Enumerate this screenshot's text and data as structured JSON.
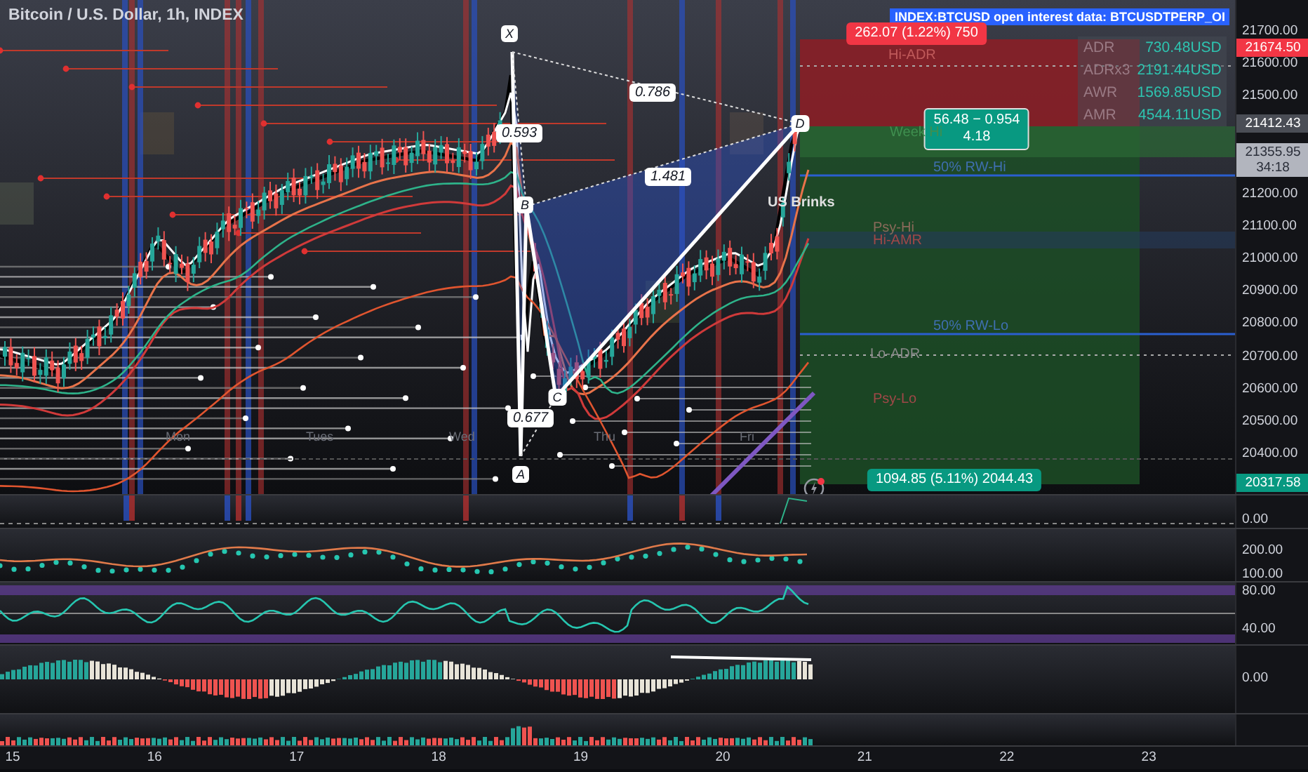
{
  "chart": {
    "title": "Bitcoin / U.S. Dollar, 1h, INDEX",
    "info_banner": "INDEX:BTCUSD open interest data: BTCUSDTPERP_OI",
    "stats": [
      {
        "label": "ADR",
        "value": "730.48USD"
      },
      {
        "label": "ADRx3",
        "value": "2191.44USD"
      },
      {
        "label": "AWR",
        "value": "1569.85USD"
      },
      {
        "label": "AMR",
        "value": "4544.11USD"
      }
    ],
    "pattern_points": [
      "X",
      "A",
      "B",
      "C",
      "D"
    ],
    "ratios": [
      "0.786",
      "0.593",
      "1.481",
      "0.677"
    ],
    "measure_labels": [
      {
        "text": "262.07 (1.22%) 750",
        "color": "#f23645"
      },
      {
        "text": "56.48 − 0.954",
        "subtext": "4.18",
        "color": "#089981"
      },
      {
        "text": "1094.85 (5.11%) 2044.43",
        "color": "#089981"
      }
    ],
    "level_labels": [
      {
        "text": "Hi-ADR",
        "color": "#c05a5a"
      },
      {
        "text": "Week Hi",
        "color": "#3f8f4f"
      },
      {
        "text": "50% RW-Hi",
        "color": "#3f6fb0"
      },
      {
        "text": "Psy-Hi",
        "color": "#8a6a5a"
      },
      {
        "text": "Hi-AMR",
        "color": "#a04848"
      },
      {
        "text": "50% RW-Lo",
        "color": "#3f6fb0"
      },
      {
        "text": "Lo-ADR",
        "color": "#8a8a8a"
      },
      {
        "text": "Psy-Lo",
        "color": "#a04848"
      }
    ],
    "session_label": "US Brinks",
    "day_labels": [
      "Mon",
      "Tues",
      "Wed",
      "Thu",
      "Fri"
    ]
  },
  "price_scale": {
    "ticks": [
      "21700.00",
      "21600.00",
      "21500.00",
      "21200.00",
      "21100.00",
      "21000.00",
      "20900.00",
      "20800.00",
      "20700.00",
      "20600.00",
      "20500.00",
      "20400.00"
    ],
    "markers": [
      {
        "price": "21674.50",
        "color": "#f23645"
      },
      {
        "price": "21412.43",
        "color": "#4a4d55"
      },
      {
        "price": "21355.95",
        "countdown": "34:18",
        "color": "#b2b5be"
      },
      {
        "price": "20317.58",
        "color": "#089981"
      }
    ]
  },
  "indicator_panes": [
    {
      "kind": "flat",
      "ticks": [
        "0.00"
      ]
    },
    {
      "kind": "dots",
      "ticks": [
        "200.00",
        "100.00"
      ]
    },
    {
      "kind": "oscillator",
      "ticks": [
        "80.00",
        "40.00"
      ]
    },
    {
      "kind": "histogram",
      "ticks": [
        "0.00"
      ]
    },
    {
      "kind": "volume"
    }
  ],
  "time_scale": [
    "15",
    "16",
    "17",
    "18",
    "19",
    "20",
    "21",
    "22",
    "23"
  ]
}
